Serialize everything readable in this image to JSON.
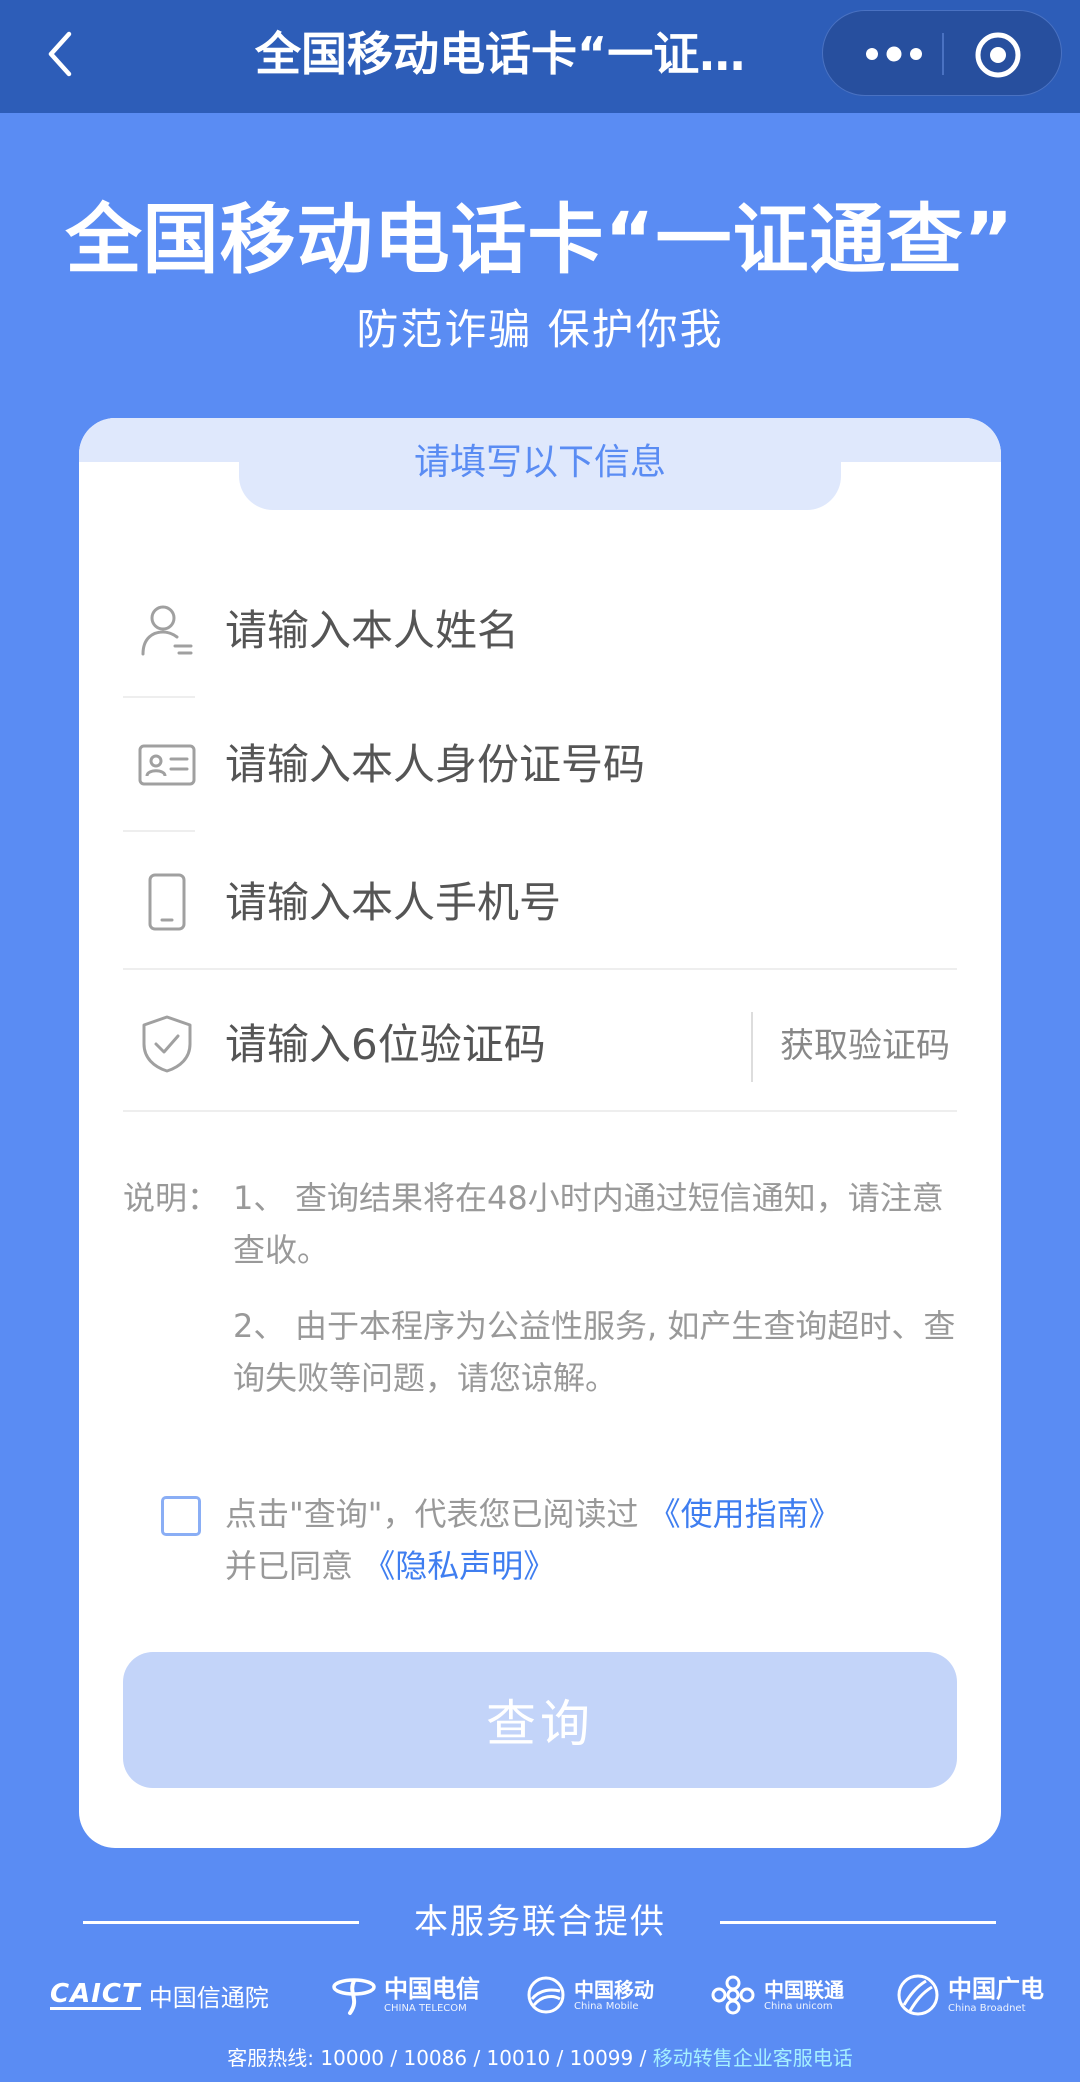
{
  "nav": {
    "title": "全国移动电话卡“一证…"
  },
  "hero": {
    "title": "全国移动电话卡“一证通查”",
    "subtitle": "防范诈骗 保护你我"
  },
  "form": {
    "header": "请填写以下信息",
    "name_placeholder": "请输入本人姓名",
    "id_placeholder": "请输入本人身份证号码",
    "phone_placeholder": "请输入本人手机号",
    "code_placeholder": "请输入6位验证码",
    "get_code_label": "获取验证码"
  },
  "notes": {
    "label": "说明：",
    "items": [
      {
        "num": "1、",
        "text": "查询结果将在48小时内通过短信通知，请注意查收。"
      },
      {
        "num": "2、",
        "text": "由于本程序为公益性服务, 如产生查询超时、查询失败等问题，请您谅解。"
      }
    ]
  },
  "agreement": {
    "checked": false,
    "text_before": "点击\"查询\"，代表您已阅读过",
    "guide_link": "《使用指南》",
    "text_mid": "并已同意",
    "privacy_link": "《隐私声明》"
  },
  "query_button": "查询",
  "footer": {
    "title": "本服务联合提供",
    "logos": {
      "caict_mark": "CAICT",
      "caict_name": "中国信通院",
      "telecom_name": "中国电信",
      "telecom_sub": "CHINA TELECOM",
      "mobile_name": "中国移动",
      "mobile_sub": "China Mobile",
      "unicom_name": "中国联通",
      "unicom_sub": "China unicom",
      "broadnet_name": "中国广电",
      "broadnet_sub": "China Broadnet"
    },
    "hotline_text": "客服热线: 10000 / 10086 / 10010 / 10099 / ",
    "hotline_link": "移动转售企业客服电话"
  },
  "colors": {
    "background": "#5a8cf3",
    "navbar": "#2d5db8",
    "accent": "#3f7ef0",
    "button_disabled": "#c3d4f9"
  }
}
